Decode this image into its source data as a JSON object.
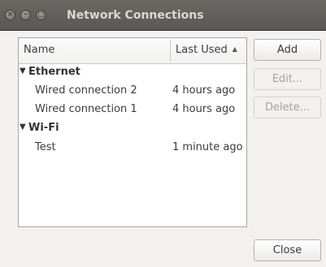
{
  "window": {
    "title": "Network Connections",
    "close_glyph": "×",
    "minimize_glyph": "–",
    "maximize_glyph": "□"
  },
  "table": {
    "columns": [
      {
        "label": "Name"
      },
      {
        "label": "Last Used",
        "sort": "ascending",
        "sort_glyph": "▲"
      }
    ],
    "expander_glyph": "▼",
    "groups": [
      {
        "name": "Ethernet",
        "expanded": true,
        "connections": [
          {
            "name": "Wired connection 2",
            "last_used": "4 hours ago"
          },
          {
            "name": "Wired connection 1",
            "last_used": "4 hours ago"
          }
        ]
      },
      {
        "name": "Wi-Fi",
        "expanded": true,
        "connections": [
          {
            "name": "Test",
            "last_used": "1 minute ago"
          }
        ]
      }
    ]
  },
  "buttons": {
    "add": "Add",
    "edit": "Edit...",
    "delete": "Delete...",
    "close": "Close"
  }
}
